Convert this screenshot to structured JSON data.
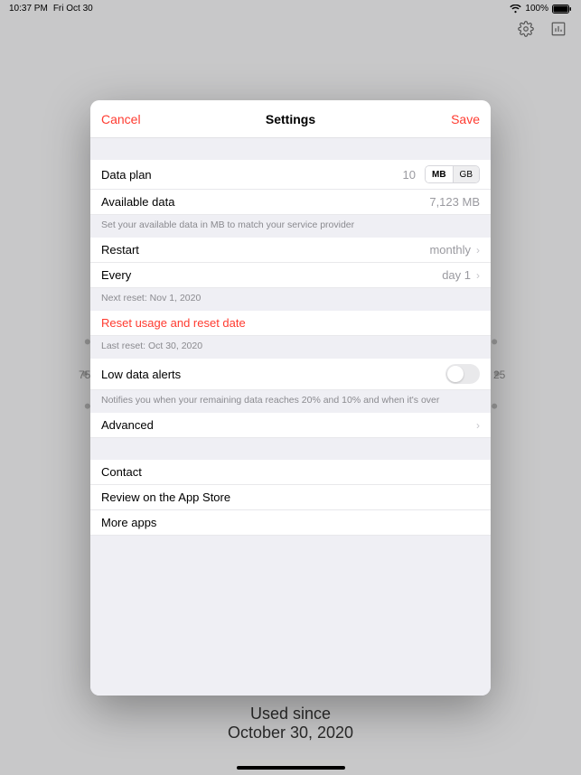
{
  "status": {
    "time": "10:37 PM",
    "date": "Fri Oct 30",
    "battery_pct": "100%"
  },
  "gauge": {
    "label_75": "75",
    "label_25": "25"
  },
  "used_since": {
    "line1": "Used since",
    "line2": "October 30, 2020"
  },
  "modal": {
    "cancel": "Cancel",
    "title": "Settings",
    "save": "Save",
    "data_plan": {
      "label": "Data plan",
      "value": "10",
      "unit_mb": "MB",
      "unit_gb": "GB"
    },
    "available": {
      "label": "Available data",
      "value": "7,123 MB",
      "note": "Set your available data in MB to match your service provider"
    },
    "restart": {
      "label": "Restart",
      "value": "monthly"
    },
    "every": {
      "label": "Every",
      "value": "day 1",
      "note": "Next reset: Nov 1, 2020"
    },
    "reset": {
      "label": "Reset usage and reset date",
      "note": "Last reset: Oct 30, 2020"
    },
    "low_alerts": {
      "label": "Low data alerts",
      "note": "Notifies you when your remaining data reaches 20% and 10% and when it's over"
    },
    "advanced": {
      "label": "Advanced"
    },
    "contact": {
      "label": "Contact"
    },
    "review": {
      "label": "Review on the App Store"
    },
    "more": {
      "label": "More apps"
    }
  }
}
